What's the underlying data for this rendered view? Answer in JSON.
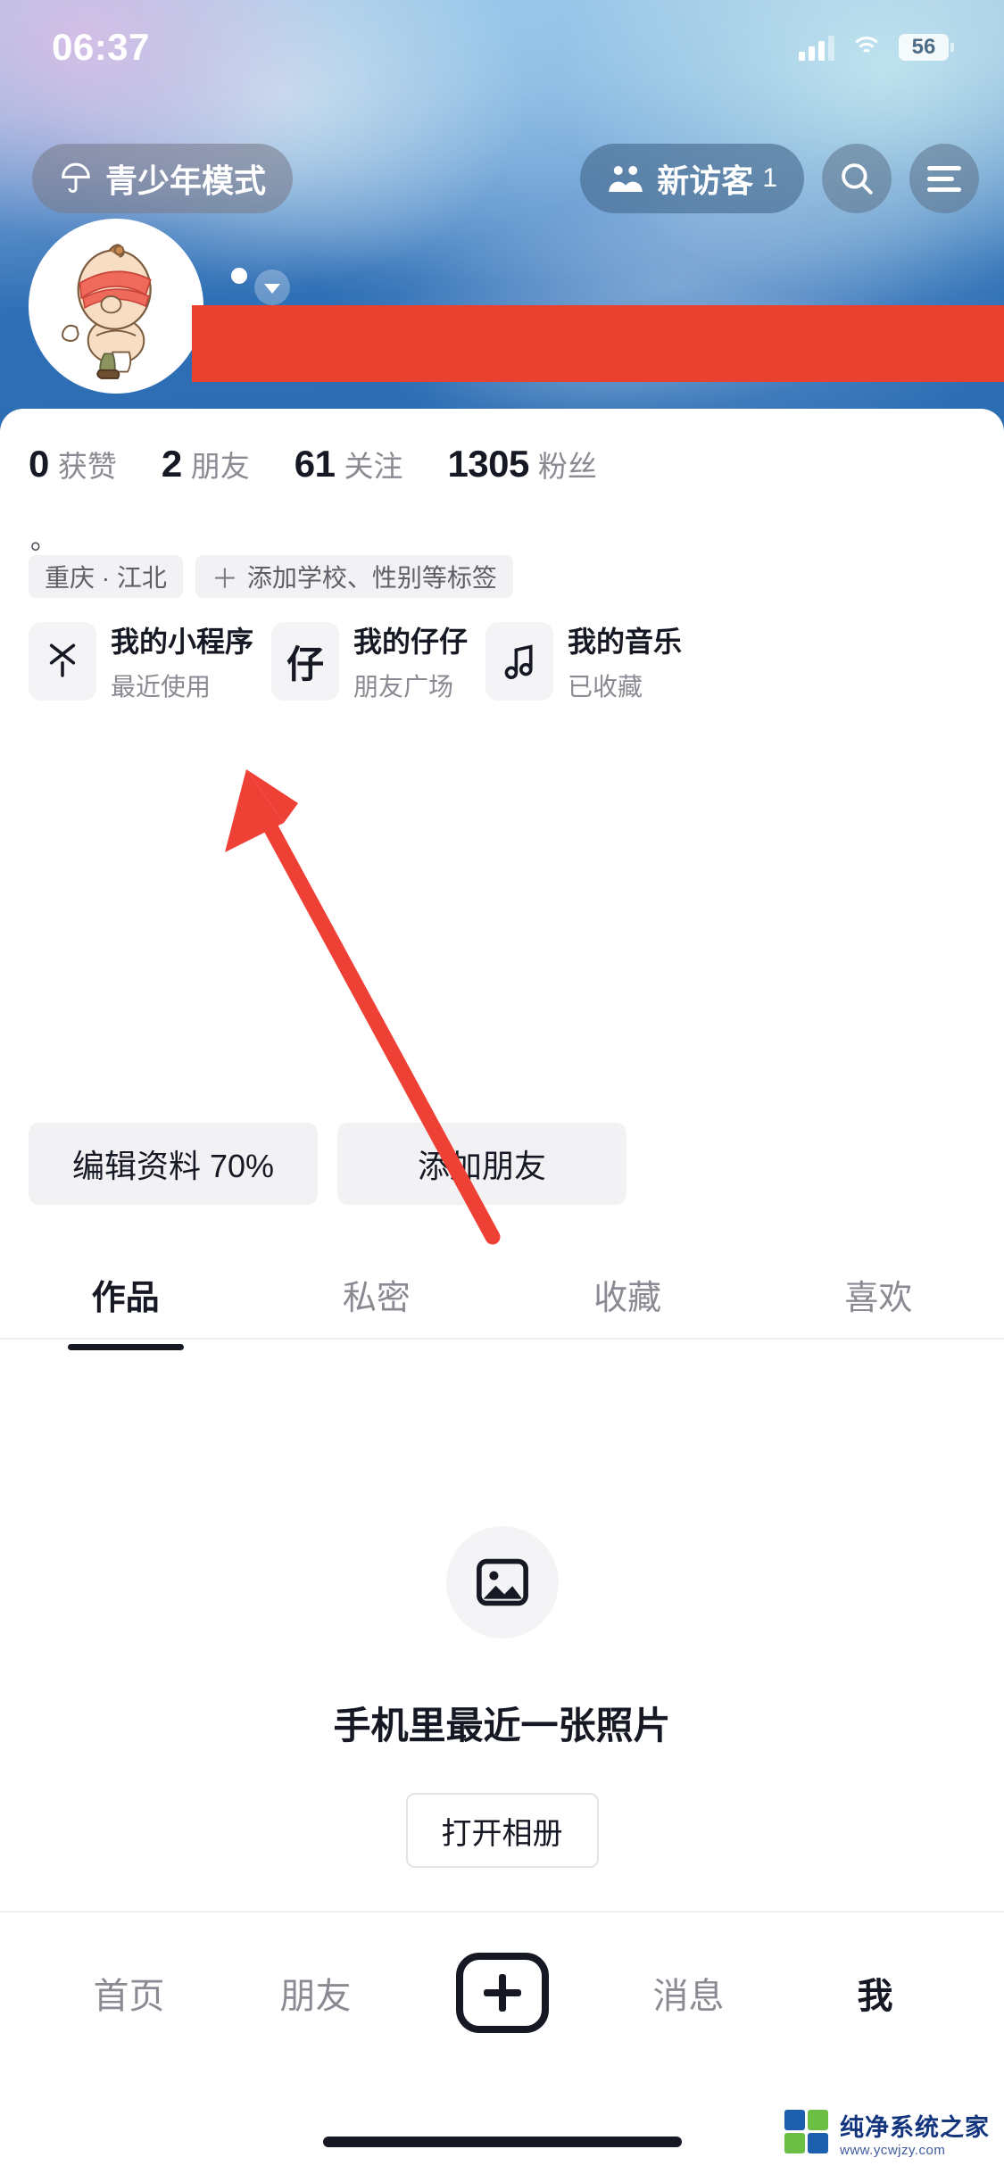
{
  "status_bar": {
    "time": "06:37",
    "moon_icon": "moon-icon",
    "signal_icon": "signal-bars-icon",
    "wifi_icon": "wifi-icon",
    "battery": "56"
  },
  "top_nav": {
    "youth_mode": {
      "label": "青少年模式",
      "icon": "umbrella-icon"
    },
    "visitors": {
      "label": "新访客",
      "count": "1",
      "icon": "friends-icon"
    },
    "search_icon": "search-icon",
    "menu_icon": "hamburger-menu-icon"
  },
  "profile": {
    "avatar_alt": "cartoon-baby-avatar",
    "name_redacted": true,
    "dropdown_icon": "chevron-down-icon",
    "bio": "。",
    "stats": [
      {
        "num": "0",
        "label": "获赞"
      },
      {
        "num": "2",
        "label": "朋友"
      },
      {
        "num": "61",
        "label": "关注"
      },
      {
        "num": "1305",
        "label": "粉丝"
      }
    ],
    "tags": [
      {
        "text": "重庆 · 江北",
        "has_plus": false
      },
      {
        "text": "添加学校、性别等标签",
        "has_plus": true
      }
    ]
  },
  "mini_cards": [
    {
      "icon": "douyin-logo-icon",
      "icon_char": "火",
      "title": "我的小程序",
      "subtitle": "最近使用"
    },
    {
      "icon": "zaizai-icon",
      "icon_char": "仔",
      "title": "我的仔仔",
      "subtitle": "朋友广场"
    },
    {
      "icon": "music-note-icon",
      "icon_char": "♫",
      "title": "我的音乐",
      "subtitle": "已收藏"
    }
  ],
  "actions": {
    "edit_profile": "编辑资料 70%",
    "add_friend": "添加朋友"
  },
  "tabs": [
    {
      "label": "作品",
      "active": true
    },
    {
      "label": "私密",
      "active": false
    },
    {
      "label": "收藏",
      "active": false
    },
    {
      "label": "喜欢",
      "active": false
    }
  ],
  "empty_state": {
    "icon": "image-placeholder-icon",
    "text": "手机里最近一张照片",
    "button": "打开相册"
  },
  "bottom_nav": [
    {
      "label": "首页",
      "active": false
    },
    {
      "label": "朋友",
      "active": false
    },
    {
      "label": "",
      "active": false,
      "icon": "plus-icon"
    },
    {
      "label": "消息",
      "active": false
    },
    {
      "label": "我",
      "active": true
    }
  ],
  "watermark": {
    "name": "纯净系统之家",
    "url": "www.ycwjzy.com"
  },
  "annotation": {
    "type": "arrow",
    "color": "#ef4035",
    "points_to": "编辑资料 70%"
  },
  "colors": {
    "cover_blue": "#2f6fb5",
    "redaction_red": "#e8412f",
    "accent_dark": "#161823",
    "muted_text": "#8a8b92",
    "chip_bg": "#f2f2f4"
  }
}
